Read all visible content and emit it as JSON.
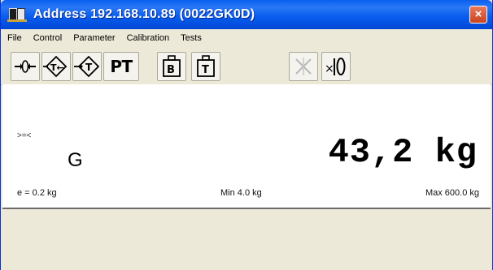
{
  "window": {
    "title": "Address 192.168.10.89 (0022GK0D)",
    "close_label": "×"
  },
  "menu": {
    "items": [
      "File",
      "Control",
      "Parameter",
      "Calibration",
      "Tests"
    ]
  },
  "toolbar": {
    "buttons": [
      {
        "name": "zero-button",
        "icon": "zero-icon"
      },
      {
        "name": "tare-button",
        "icon": "tare-icon"
      },
      {
        "name": "tare-clear-button",
        "icon": "tare-clear-icon"
      },
      {
        "name": "preset-tare-button",
        "label": "PT"
      },
      {
        "name": "brutto-button",
        "icon": "brutto-weight-icon"
      },
      {
        "name": "tare-display-button",
        "icon": "tare-weight-icon"
      },
      {
        "name": "disabled-button",
        "icon": "disabled-x-icon",
        "disabled": true
      },
      {
        "name": "x10-button",
        "icon": "x10-icon"
      }
    ]
  },
  "display": {
    "stable_indicator": ">=<",
    "mode": "G",
    "weight": "43,2 kg",
    "division": "e = 0.2 kg",
    "min": "Min 4.0 kg",
    "max": "Max 600.0 kg"
  },
  "colors": {
    "titlebar": "#0a5ff0",
    "window_bg": "#ece9d8",
    "close": "#c9431f"
  }
}
